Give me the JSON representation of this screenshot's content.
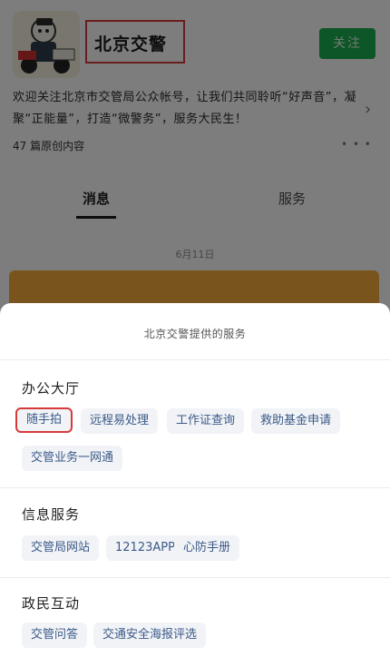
{
  "profile": {
    "account_name": "北京交警",
    "follow_label": "关注",
    "description": "欢迎关注北京市交管局公众帐号，让我们共同聆听“好声音”，凝聚“正能量”，打造“微警务”，服务大民生！",
    "original_count": "47 篇原创内容",
    "more_dots": "• • •"
  },
  "tabs": {
    "messages": "消息",
    "services": "服务"
  },
  "feed": {
    "date": "6月11日"
  },
  "sheet": {
    "title": "北京交警提供的服务",
    "sections": [
      {
        "title": "办公大厅",
        "items": [
          "随手拍",
          "远程易处理",
          "工作证查询",
          "救助基金申请",
          "交管业务一网通"
        ]
      },
      {
        "title": "信息服务",
        "items": [
          "交管局网站",
          "12123APP",
          "心防手册"
        ]
      },
      {
        "title": "政民互动",
        "items": [
          "交管问答",
          "交通安全海报评选"
        ]
      }
    ]
  },
  "colors": {
    "follow": "#1aad4e",
    "highlight": "#d63a3a",
    "chip_text": "#3b5a88",
    "chip_bg": "#f1f3f7"
  }
}
